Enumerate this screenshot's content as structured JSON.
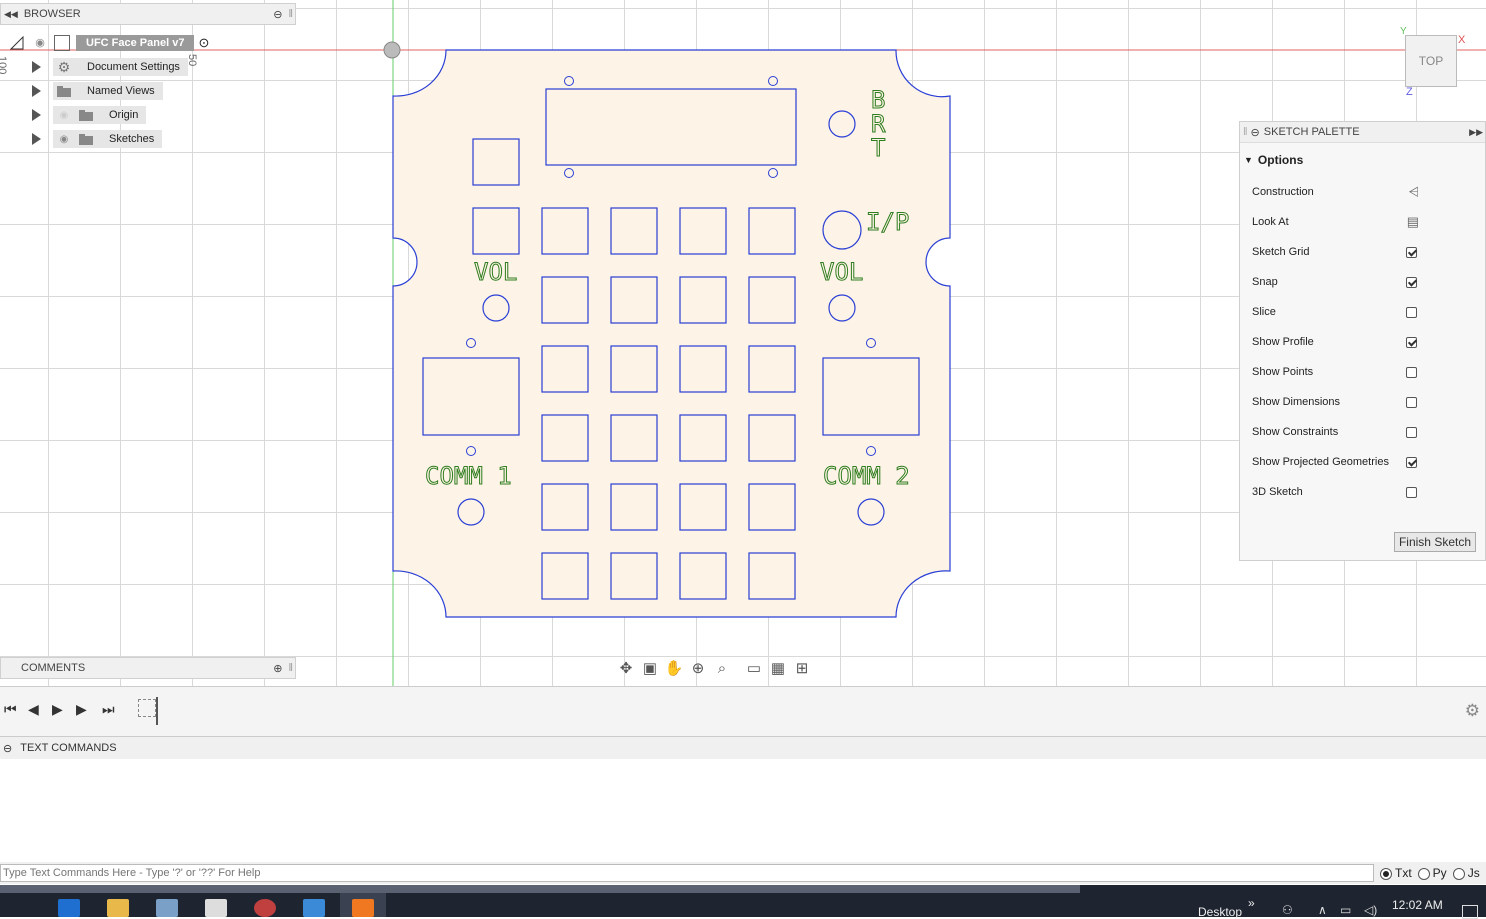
{
  "browser": {
    "header": "BROWSER",
    "document_name": "UFC Face Panel v7",
    "items": [
      {
        "label": "Document Settings",
        "icon": "gear-icon"
      },
      {
        "label": "Named Views",
        "icon": "folder-icon"
      },
      {
        "label": "Origin",
        "icon": "folder-icon"
      },
      {
        "label": "Sketches",
        "icon": "folder-icon"
      }
    ]
  },
  "ruler": {
    "v1": "100",
    "v2": "50"
  },
  "viewcube": {
    "face": "TOP",
    "x": "X",
    "y": "Y",
    "z": "Z"
  },
  "sketch_labels": {
    "brt_b": "B",
    "brt_r": "R",
    "brt_t": "T",
    "ip": "I/P",
    "vol_left": "VOL",
    "vol_right": "VOL",
    "comm1": "COMM 1",
    "comm2": "COMM 2"
  },
  "palette": {
    "header": "SKETCH PALETTE",
    "section": "Options",
    "rows": [
      {
        "label": "Construction",
        "type": "icon",
        "icon": "construction-icon"
      },
      {
        "label": "Look At",
        "type": "icon",
        "icon": "look-at-icon"
      },
      {
        "label": "Sketch Grid",
        "type": "check",
        "checked": true
      },
      {
        "label": "Snap",
        "type": "check",
        "checked": true
      },
      {
        "label": "Slice",
        "type": "check",
        "checked": false
      },
      {
        "label": "Show Profile",
        "type": "check",
        "checked": true
      },
      {
        "label": "Show Points",
        "type": "check",
        "checked": false
      },
      {
        "label": "Show Dimensions",
        "type": "check",
        "checked": false
      },
      {
        "label": "Show Constraints",
        "type": "check",
        "checked": false
      },
      {
        "label": "Show Projected Geometries",
        "type": "check",
        "checked": true
      },
      {
        "label": "3D Sketch",
        "type": "check",
        "checked": false
      }
    ],
    "finish_button": "Finish Sketch"
  },
  "comments": {
    "header": "COMMENTS"
  },
  "text_commands": {
    "header": "TEXT COMMANDS",
    "placeholder": "Type Text Commands Here - Type '?' or '??' For Help",
    "modes": [
      {
        "label": "Txt",
        "selected": true
      },
      {
        "label": "Py",
        "selected": false
      },
      {
        "label": "Js",
        "selected": false
      }
    ]
  },
  "taskbar": {
    "desktop_label": "Desktop",
    "chevron": "»",
    "time": "12:02 AM"
  },
  "colors": {
    "sketch_line": "#2a3fd6",
    "panel_fill": "#fdf3e6",
    "text_green": "#2e7d1e",
    "axis_red": "#e05050",
    "axis_green": "#60c060"
  }
}
